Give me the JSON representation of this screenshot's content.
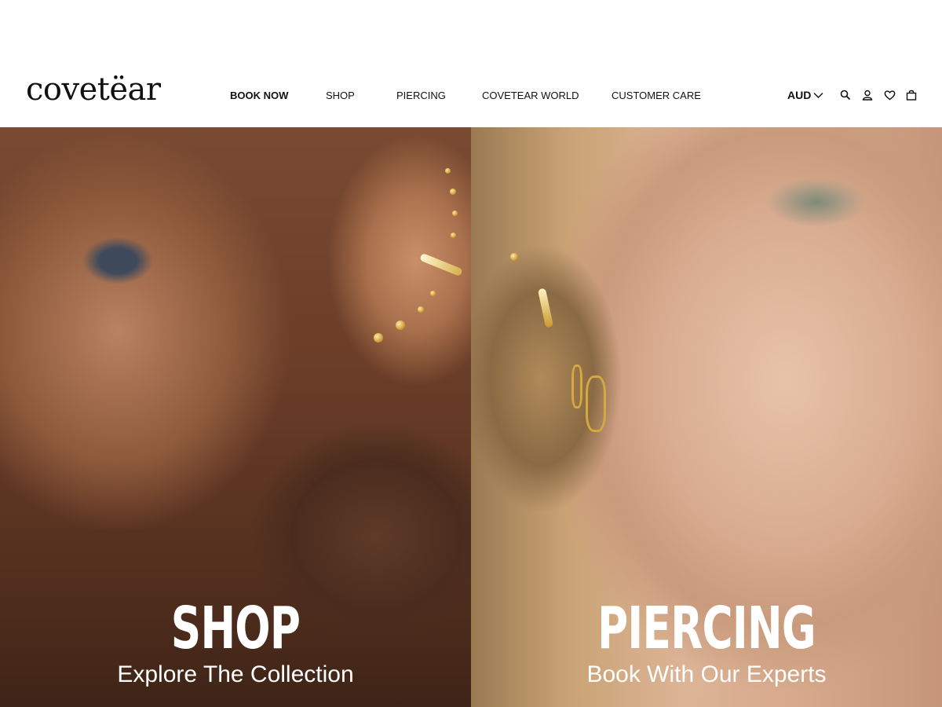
{
  "brand": {
    "logo_text": "covetëar"
  },
  "nav": {
    "items": [
      {
        "label": "BOOK NOW",
        "bold": true
      },
      {
        "label": "SHOP"
      },
      {
        "label": "PIERCING"
      },
      {
        "label": "COVETEAR WORLD"
      },
      {
        "label": "CUSTOMER CARE"
      }
    ]
  },
  "utilities": {
    "currency": "AUD",
    "icons": [
      "chevron-down-icon",
      "search-icon",
      "account-icon",
      "wishlist-icon",
      "cart-icon"
    ]
  },
  "hero": {
    "panels": [
      {
        "title": "SHOP",
        "subtitle": "Explore The Collection"
      },
      {
        "title": "PIERCING",
        "subtitle": "Book With Our Experts"
      }
    ]
  },
  "colors": {
    "text": "#111111",
    "background": "#ffffff",
    "hero_text": "#ffffff"
  }
}
